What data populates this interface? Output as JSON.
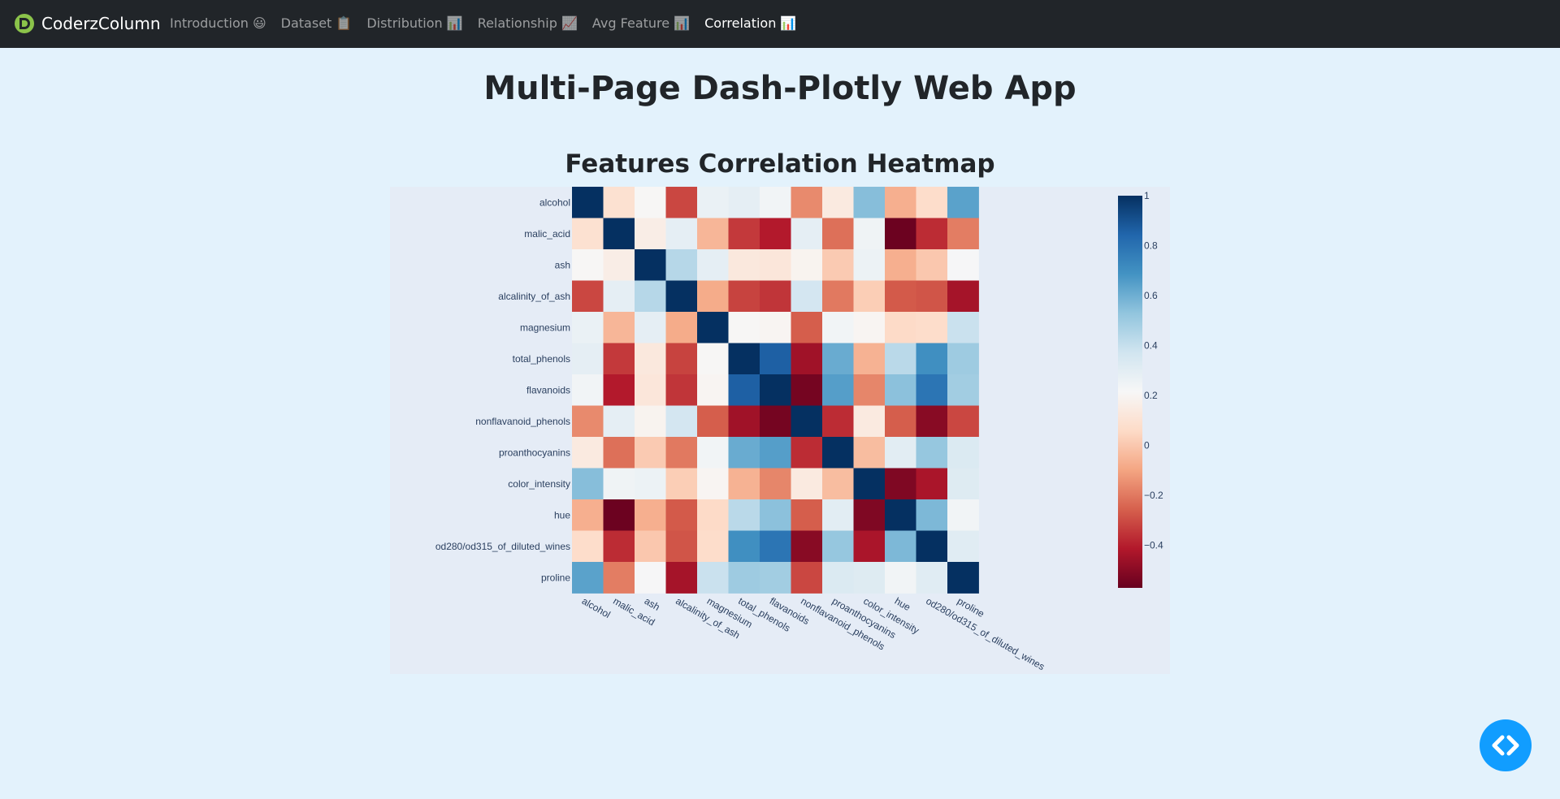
{
  "navbar": {
    "brand": "CoderzColumn",
    "links": [
      {
        "label": "Introduction 😃"
      },
      {
        "label": "Dataset 📋"
      },
      {
        "label": "Distribution 📊"
      },
      {
        "label": "Relationship 📈"
      },
      {
        "label": "Avg Feature 📊"
      },
      {
        "label": "Correlation 📊"
      }
    ],
    "active_index": 5
  },
  "page_title": "Multi-Page Dash-Plotly Web App",
  "colors": {
    "navbar_bg": "#212529",
    "page_bg": "#e3f2fc",
    "plot_bg": "#e5ecf6",
    "fab": "#119dff",
    "brand_icon": "#8bc34a",
    "colorscale": "RdBu"
  },
  "chart_data": {
    "type": "heatmap",
    "title": "Features Correlation Heatmap",
    "xlabel": "",
    "ylabel": "",
    "colorscale": "RdBu",
    "zmin": -0.57,
    "zmax": 1,
    "colorbar_ticks": [
      1,
      0.8,
      0.6,
      0.4,
      0.2,
      0,
      -0.2,
      -0.4
    ],
    "colorbar_tick_labels": [
      "1",
      "0.8",
      "0.6",
      "0.4",
      "0.2",
      "0",
      "−0.2",
      "−0.4"
    ],
    "x": [
      "alcohol",
      "malic_acid",
      "ash",
      "alcalinity_of_ash",
      "magnesium",
      "total_phenols",
      "flavanoids",
      "nonflavanoid_phenols",
      "proanthocyanins",
      "color_intensity",
      "hue",
      "od280/od315_of_diluted_wines",
      "proline"
    ],
    "y": [
      "alcohol",
      "malic_acid",
      "ash",
      "alcalinity_of_ash",
      "magnesium",
      "total_phenols",
      "flavanoids",
      "nonflavanoid_phenols",
      "proanthocyanins",
      "color_intensity",
      "hue",
      "od280/od315_of_diluted_wines",
      "proline"
    ],
    "z": [
      [
        1.0,
        0.09,
        0.21,
        -0.31,
        0.27,
        0.29,
        0.24,
        -0.16,
        0.14,
        0.55,
        -0.07,
        0.07,
        0.64
      ],
      [
        0.09,
        1.0,
        0.16,
        0.29,
        -0.05,
        -0.34,
        -0.41,
        0.29,
        -0.22,
        0.25,
        -0.56,
        -0.37,
        -0.19
      ],
      [
        0.21,
        0.16,
        1.0,
        0.44,
        0.29,
        0.13,
        0.12,
        0.19,
        0.01,
        0.26,
        -0.07,
        0.0,
        0.22
      ],
      [
        -0.31,
        0.29,
        0.44,
        1.0,
        -0.08,
        -0.32,
        -0.35,
        0.36,
        -0.2,
        0.02,
        -0.27,
        -0.28,
        -0.44
      ],
      [
        0.27,
        -0.05,
        0.29,
        -0.08,
        1.0,
        0.21,
        0.2,
        -0.26,
        0.24,
        0.2,
        0.06,
        0.07,
        0.39
      ],
      [
        0.29,
        -0.34,
        0.13,
        -0.32,
        0.21,
        1.0,
        0.86,
        -0.45,
        0.61,
        -0.06,
        0.43,
        0.7,
        0.5
      ],
      [
        0.24,
        -0.41,
        0.12,
        -0.35,
        0.2,
        0.86,
        1.0,
        -0.54,
        0.65,
        -0.17,
        0.54,
        0.79,
        0.49
      ],
      [
        -0.16,
        0.29,
        0.19,
        0.36,
        -0.26,
        -0.45,
        -0.54,
        1.0,
        -0.37,
        0.14,
        -0.26,
        -0.5,
        -0.31
      ],
      [
        0.14,
        -0.22,
        0.01,
        -0.2,
        0.24,
        0.61,
        0.65,
        -0.37,
        1.0,
        -0.03,
        0.3,
        0.52,
        0.33
      ],
      [
        0.55,
        0.25,
        0.26,
        0.02,
        0.2,
        -0.06,
        -0.17,
        0.14,
        -0.03,
        1.0,
        -0.52,
        -0.43,
        0.32
      ],
      [
        -0.07,
        -0.56,
        -0.07,
        -0.27,
        0.06,
        0.43,
        0.54,
        -0.26,
        0.3,
        -0.52,
        1.0,
        0.57,
        0.24
      ],
      [
        0.07,
        -0.37,
        0.0,
        -0.28,
        0.07,
        0.7,
        0.79,
        -0.5,
        0.52,
        -0.43,
        0.57,
        1.0,
        0.31
      ],
      [
        0.64,
        -0.19,
        0.22,
        -0.44,
        0.39,
        0.5,
        0.49,
        -0.31,
        0.33,
        0.32,
        0.24,
        0.31,
        1.0
      ]
    ]
  }
}
